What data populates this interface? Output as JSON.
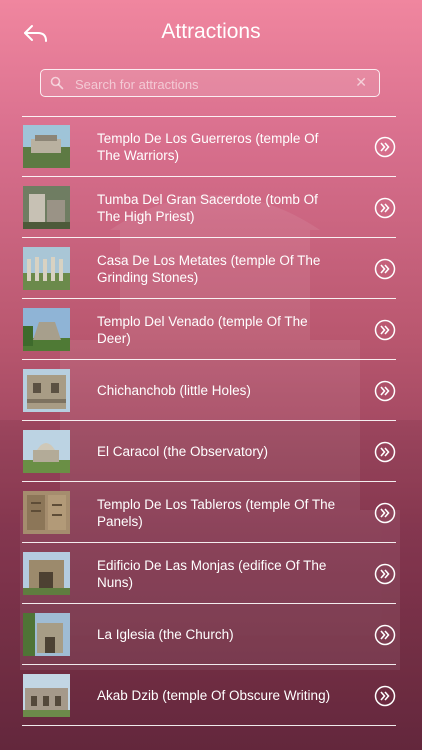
{
  "header": {
    "title": "Attractions"
  },
  "search": {
    "placeholder": "Search for attractions",
    "value": ""
  },
  "items": [
    {
      "label": "Templo De Los Guerreros (temple Of The Warriors)"
    },
    {
      "label": "Tumba Del Gran Sacerdote (tomb Of The High Priest)"
    },
    {
      "label": "Casa De Los Metates (temple Of The Grinding Stones)"
    },
    {
      "label": "Templo Del Venado (temple Of The Deer)"
    },
    {
      "label": "Chichanchob (little Holes)"
    },
    {
      "label": "El Caracol (the Observatory)"
    },
    {
      "label": "Templo De Los Tableros (temple Of The Panels)"
    },
    {
      "label": "Edificio De Las Monjas (edifice Of The Nuns)"
    },
    {
      "label": "La Iglesia (the Church)"
    },
    {
      "label": "Akab Dzib (temple Of Obscure Writing)"
    }
  ],
  "colors": {
    "accent": "#ffffff",
    "gradient_top": "#f0869f",
    "gradient_bottom": "#6a2a40"
  }
}
